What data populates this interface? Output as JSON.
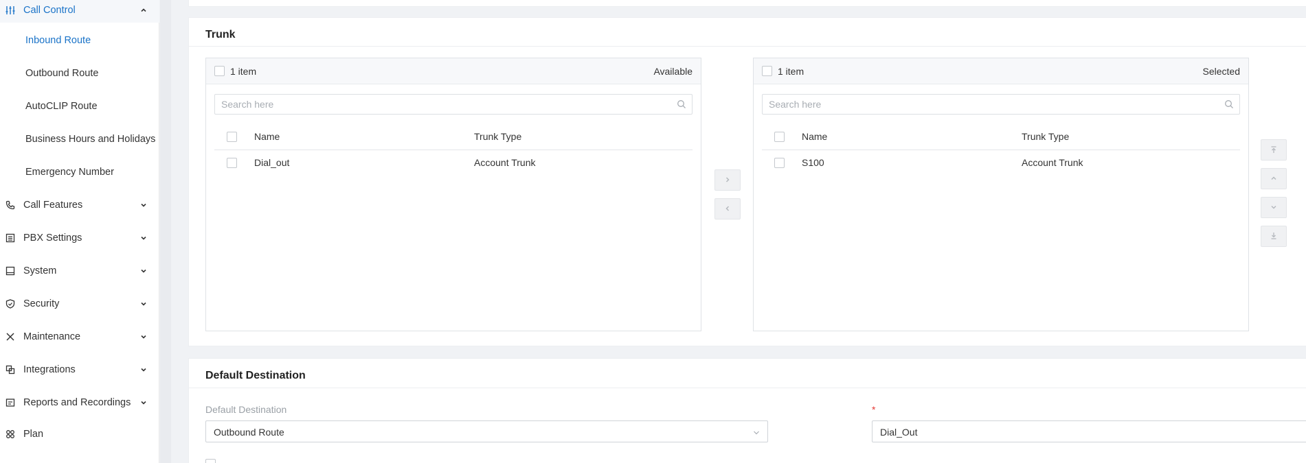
{
  "sidebar": {
    "call_control": {
      "label": "Call Control"
    },
    "call_control_items": [
      {
        "label": "Inbound Route"
      },
      {
        "label": "Outbound Route"
      },
      {
        "label": "AutoCLIP Route"
      },
      {
        "label": "Business Hours and Holidays"
      },
      {
        "label": "Emergency Number"
      }
    ],
    "sections": [
      {
        "label": "Call Features"
      },
      {
        "label": "PBX Settings"
      },
      {
        "label": "System"
      },
      {
        "label": "Security"
      },
      {
        "label": "Maintenance"
      },
      {
        "label": "Integrations"
      },
      {
        "label": "Reports and Recordings"
      },
      {
        "label": "Plan"
      }
    ]
  },
  "trunk": {
    "title": "Trunk",
    "available": {
      "count_label": "1 item",
      "side_label": "Available",
      "search_placeholder": "Search here",
      "columns": [
        "Name",
        "Trunk Type"
      ],
      "rows": [
        {
          "name": "Dial_out",
          "type": "Account Trunk"
        }
      ]
    },
    "selected": {
      "count_label": "1 item",
      "side_label": "Selected",
      "search_placeholder": "Search here",
      "columns": [
        "Name",
        "Trunk Type"
      ],
      "rows": [
        {
          "name": "S100",
          "type": "Account Trunk"
        }
      ]
    }
  },
  "default_destination": {
    "title": "Default Destination",
    "field_label": "Default Destination",
    "destination_value": "Outbound Route",
    "required_mark": "*",
    "target_value": "Dial_Out"
  },
  "colors": {
    "accent": "#1a73c8",
    "required": "#e53935"
  }
}
